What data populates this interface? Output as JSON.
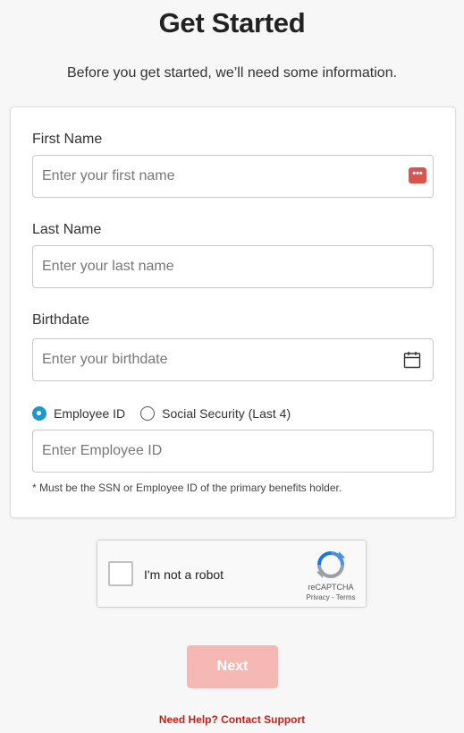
{
  "header": {
    "title": "Get Started",
    "subtitle": "Before you get started, we’ll need some information."
  },
  "form": {
    "first_name": {
      "label": "First Name",
      "placeholder": "Enter your first name",
      "value": ""
    },
    "last_name": {
      "label": "Last Name",
      "placeholder": "Enter your last name",
      "value": ""
    },
    "birthdate": {
      "label": "Birthdate",
      "placeholder": "Enter your birthdate",
      "value": ""
    },
    "id_type": {
      "options": [
        "Employee ID",
        "Social Security (Last 4)"
      ],
      "selected": "Employee ID"
    },
    "id_field": {
      "placeholder": "Enter Employee ID",
      "value": ""
    },
    "footnote": "* Must be the SSN or Employee ID of the primary benefits holder."
  },
  "captcha": {
    "label": "I'm not a robot",
    "brand": "reCAPTCHA",
    "links": "Privacy - Terms",
    "checked": false
  },
  "actions": {
    "next_label": "Next",
    "help_link": "Need Help? Contact Support"
  },
  "icons": {
    "password_manager": "password-manager-icon",
    "calendar": "calendar-icon",
    "recaptcha": "recaptcha-logo-icon"
  },
  "colors": {
    "accent_red": "#c0221c",
    "next_button_disabled": "#f6b8b4",
    "radio_selected": "#2196c9",
    "password_icon": "#d9534f"
  }
}
